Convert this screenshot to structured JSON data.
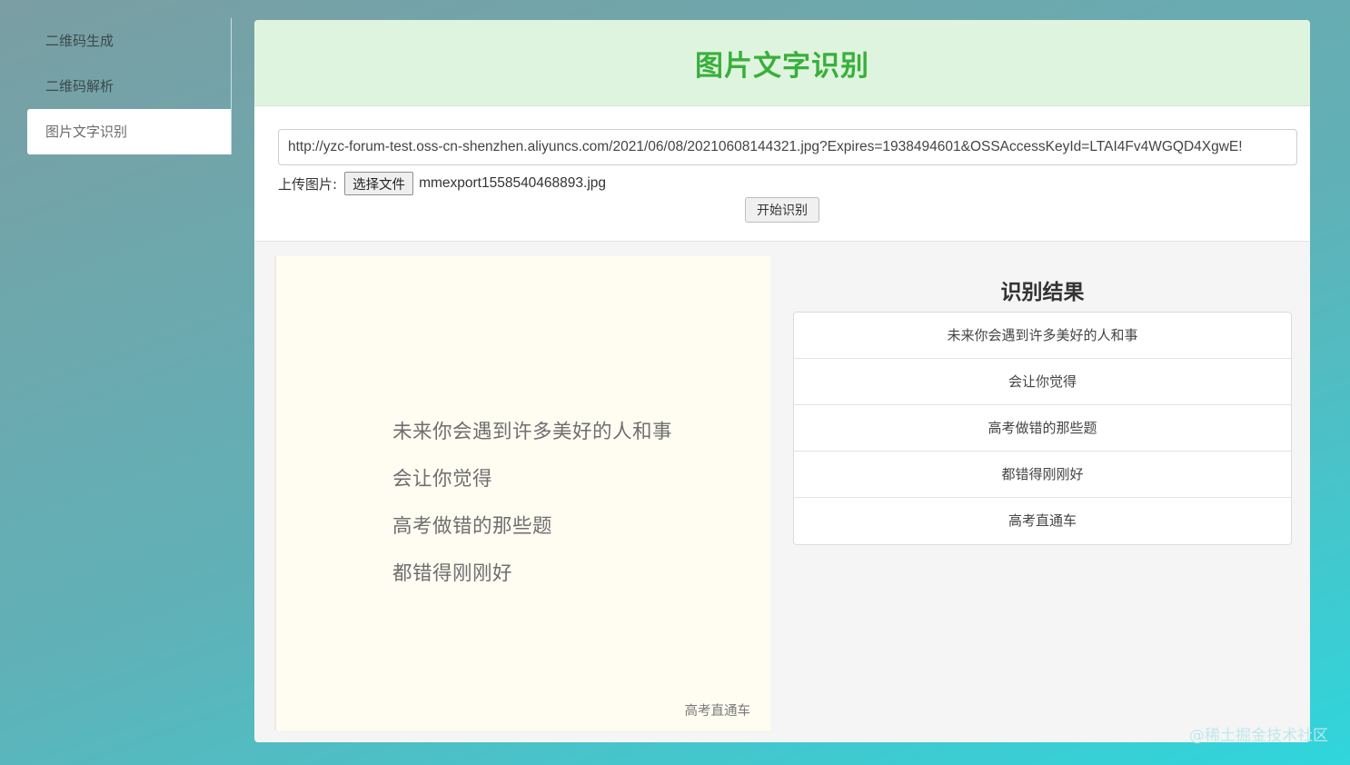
{
  "sidebar": {
    "items": [
      {
        "label": "二维码生成"
      },
      {
        "label": "二维码解析"
      },
      {
        "label": "图片文字识别"
      }
    ]
  },
  "card": {
    "title": "图片文字识别"
  },
  "form": {
    "url_value": "http://yzc-forum-test.oss-cn-shenzhen.aliyuncs.com/2021/06/08/20210608144321.jpg?Expires=1938494601&OSSAccessKeyId=LTAI4Fv4WGQD4XgwE!",
    "upload_label": "上传图片:",
    "choose_file_label": "选择文件",
    "file_name": "mmexport1558540468893.jpg",
    "start_button_label": "开始识别"
  },
  "image_preview": {
    "lines": [
      "未来你会遇到许多美好的人和事",
      "会让你觉得",
      "高考做错的那些题",
      "都错得刚刚好"
    ],
    "footer": "高考直通车"
  },
  "result": {
    "title": "识别结果",
    "items": [
      "未来你会遇到许多美好的人和事",
      "会让你觉得",
      "高考做错的那些题",
      "都错得刚刚好",
      "高考直通车"
    ]
  },
  "watermark": "@稀土掘金技术社区"
}
